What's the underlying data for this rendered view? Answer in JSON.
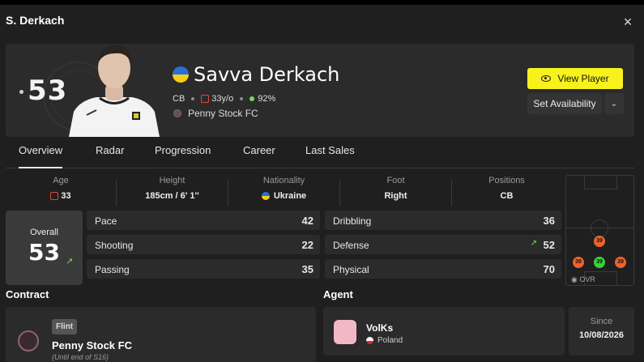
{
  "modal": {
    "title": "S. Derkach",
    "close_icon": "×"
  },
  "player": {
    "rating": "53",
    "name": "Savva Derkach",
    "position": "CB",
    "age_short": "33y/o",
    "condition": "92%",
    "club": "Penny Stock FC"
  },
  "actions": {
    "view_player": "View Player",
    "set_availability": "Set Availability",
    "chevron": "⌄"
  },
  "tabs": [
    "Overview",
    "Radar",
    "Progression",
    "Career",
    "Last Sales"
  ],
  "info": {
    "age": {
      "label": "Age",
      "value": "33"
    },
    "height": {
      "label": "Height",
      "value": "185cm / 6' 1''"
    },
    "nationality": {
      "label": "Nationality",
      "value": "Ukraine"
    },
    "foot": {
      "label": "Foot",
      "value": "Right"
    },
    "positions": {
      "label": "Positions",
      "value": "CB"
    }
  },
  "overall": {
    "label": "Overall",
    "value": "53"
  },
  "stats": {
    "pace": {
      "label": "Pace",
      "value": "42"
    },
    "shooting": {
      "label": "Shooting",
      "value": "22"
    },
    "passing": {
      "label": "Passing",
      "value": "35"
    },
    "dribbling": {
      "label": "Dribbling",
      "value": "36"
    },
    "defense": {
      "label": "Defense",
      "value": "52"
    },
    "physical": {
      "label": "Physical",
      "value": "70"
    }
  },
  "pitch": {
    "positions": [
      "39",
      "39",
      "39",
      "39"
    ],
    "ovr_label": "OVR",
    "colors": {
      "orange": "#f0622d",
      "green": "#37d13b"
    }
  },
  "contract": {
    "title": "Contract",
    "tier": "Flint",
    "club": "Penny Stock FC",
    "until": "(Until end of S16)"
  },
  "agent": {
    "title": "Agent",
    "name": "VolKs",
    "country": "Poland",
    "since_label": "Since",
    "since_value": "10/08/2026"
  },
  "colors": {
    "accent": "#f8f21c",
    "background": "#1f1f1f",
    "card": "#2b2b2b",
    "positive": "#7ed957"
  }
}
